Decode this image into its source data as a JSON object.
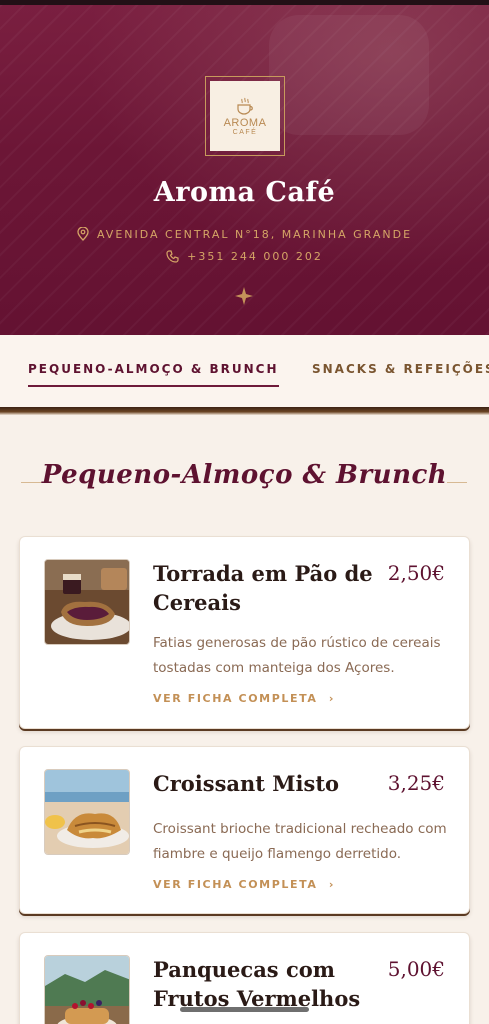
{
  "hero": {
    "logo": {
      "word": "AROMA",
      "sub": "CAFÉ"
    },
    "title": "Aroma Café",
    "address": "AVENIDA CENTRAL N°18, MARINHA GRANDE",
    "phone": "+351 244 000 202"
  },
  "tabs": [
    {
      "label": "PEQUENO-ALMOÇO & BRUNCH",
      "active": true
    },
    {
      "label": "SNACKS & REFEIÇÕES",
      "active": false
    }
  ],
  "section": {
    "title": "Pequeno-Almoço & Brunch"
  },
  "items": [
    {
      "name": "Torrada em Pão de Cereais",
      "price": "2,50€",
      "description": "Fatias generosas de pão rústico de cereais tostadas com manteiga dos Açores.",
      "link": "VER FICHA COMPLETA"
    },
    {
      "name": "Croissant Misto",
      "price": "3,25€",
      "description": "Croissant brioche tradicional recheado com fiambre e queijo flamengo derretido.",
      "link": "VER FICHA COMPLETA"
    },
    {
      "name": "Panquecas com Frutos Vermelhos",
      "price": "5,00€",
      "description": "",
      "link": ""
    }
  ],
  "colors": {
    "brand": "#6c1636",
    "gold": "#c39056",
    "background": "#f8f1ea"
  },
  "icons": {
    "location": "map-pin-icon",
    "phone": "phone-icon",
    "divider": "sparkle-icon",
    "chevron": "chevron-right-icon"
  }
}
